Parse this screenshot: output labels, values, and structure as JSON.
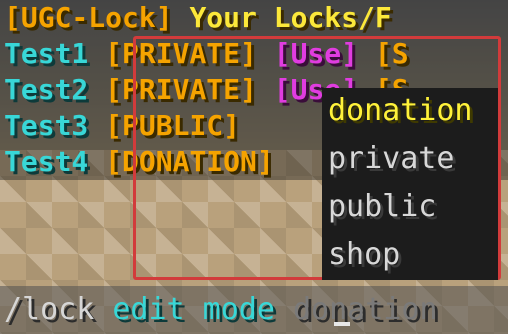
{
  "chat": {
    "header": {
      "prefix": "[UGC-Lock]",
      "text": "Your Locks/F"
    },
    "rows": [
      {
        "name": "Test1",
        "status": "[PRIVATE]",
        "action": "[Use]",
        "tail": "[S"
      },
      {
        "name": "Test2",
        "status": "[PRIVATE]",
        "action": "[Use]",
        "tail": "[S"
      },
      {
        "name": "Test3",
        "status": "[PUBLIC]",
        "action": "",
        "tail": ""
      },
      {
        "name": "Test4",
        "status": "[DONATION]",
        "action": "",
        "tail": ""
      }
    ]
  },
  "autocomplete": {
    "options": [
      "donation",
      "private",
      "public",
      "shop"
    ],
    "selected": "donation"
  },
  "command_input": {
    "command": "/lock",
    "argument": "edit mode",
    "suggestion": "donation"
  },
  "colors": {
    "highlight_border": "#d23b3b",
    "header_orange": "#f5a300",
    "name_aqua": "#38d7d7",
    "action_magenta": "#e03ce0",
    "selected_yellow": "#fff23a"
  }
}
